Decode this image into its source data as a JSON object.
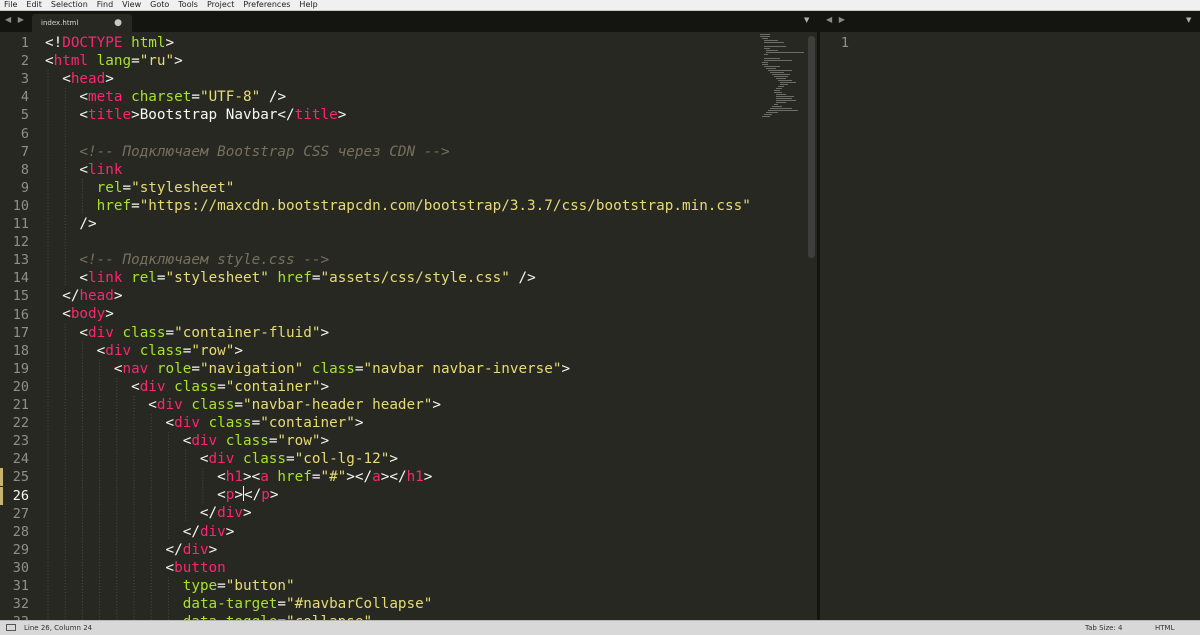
{
  "menu": [
    "File",
    "Edit",
    "Selection",
    "Find",
    "View",
    "Goto",
    "Tools",
    "Project",
    "Preferences",
    "Help"
  ],
  "tabs": {
    "left_arrows": "◀ ▶",
    "right_arrows": "◀ ▶",
    "active_file": "index.html",
    "dirty_marker": "●",
    "dropdown": "▼"
  },
  "editor_left": {
    "current_line": 26,
    "bookmarked_lines": [
      25,
      26
    ],
    "lines": [
      [
        [
          "p",
          "<!"
        ],
        [
          "t",
          "DOCTYPE"
        ],
        [
          "p",
          " "
        ],
        [
          "a",
          "html"
        ],
        [
          "p",
          ">"
        ]
      ],
      [
        [
          "p",
          "<"
        ],
        [
          "t",
          "html"
        ],
        [
          "p",
          " "
        ],
        [
          "a",
          "lang"
        ],
        [
          "p",
          "="
        ],
        [
          "s",
          "\"ru\""
        ],
        [
          "p",
          ">"
        ]
      ],
      [
        [
          "p",
          "  <"
        ],
        [
          "t",
          "head"
        ],
        [
          "p",
          ">"
        ]
      ],
      [
        [
          "p",
          "    <"
        ],
        [
          "t",
          "meta"
        ],
        [
          "p",
          " "
        ],
        [
          "a",
          "charset"
        ],
        [
          "p",
          "="
        ],
        [
          "s",
          "\"UTF-8\""
        ],
        [
          "p",
          " />"
        ]
      ],
      [
        [
          "p",
          "    <"
        ],
        [
          "t",
          "title"
        ],
        [
          "p",
          ">Bootstrap Navbar</"
        ],
        [
          "t",
          "title"
        ],
        [
          "p",
          ">"
        ]
      ],
      [],
      [
        [
          "c",
          "    <!-- Подключаем Bootstrap CSS через CDN -->"
        ]
      ],
      [
        [
          "p",
          "    <"
        ],
        [
          "t",
          "link"
        ]
      ],
      [
        [
          "p",
          "      "
        ],
        [
          "a",
          "rel"
        ],
        [
          "p",
          "="
        ],
        [
          "s",
          "\"stylesheet\""
        ]
      ],
      [
        [
          "p",
          "      "
        ],
        [
          "a",
          "href"
        ],
        [
          "p",
          "="
        ],
        [
          "s",
          "\"https://maxcdn.bootstrapcdn.com/bootstrap/3.3.7/css/bootstrap.min.css\""
        ]
      ],
      [
        [
          "p",
          "    />"
        ]
      ],
      [],
      [
        [
          "c",
          "    <!-- Подключаем style.css -->"
        ]
      ],
      [
        [
          "p",
          "    <"
        ],
        [
          "t",
          "link"
        ],
        [
          "p",
          " "
        ],
        [
          "a",
          "rel"
        ],
        [
          "p",
          "="
        ],
        [
          "s",
          "\"stylesheet\""
        ],
        [
          "p",
          " "
        ],
        [
          "a",
          "href"
        ],
        [
          "p",
          "="
        ],
        [
          "s",
          "\"assets/css/style.css\""
        ],
        [
          "p",
          " />"
        ]
      ],
      [
        [
          "p",
          "  </"
        ],
        [
          "t",
          "head"
        ],
        [
          "p",
          ">"
        ]
      ],
      [
        [
          "p",
          "  <"
        ],
        [
          "t",
          "body"
        ],
        [
          "p",
          ">"
        ]
      ],
      [
        [
          "p",
          "    <"
        ],
        [
          "t",
          "div"
        ],
        [
          "p",
          " "
        ],
        [
          "a",
          "class"
        ],
        [
          "p",
          "="
        ],
        [
          "s",
          "\"container-fluid\""
        ],
        [
          "p",
          ">"
        ]
      ],
      [
        [
          "p",
          "      <"
        ],
        [
          "t",
          "div"
        ],
        [
          "p",
          " "
        ],
        [
          "a",
          "class"
        ],
        [
          "p",
          "="
        ],
        [
          "s",
          "\"row\""
        ],
        [
          "p",
          ">"
        ]
      ],
      [
        [
          "p",
          "        <"
        ],
        [
          "t",
          "nav"
        ],
        [
          "p",
          " "
        ],
        [
          "a",
          "role"
        ],
        [
          "p",
          "="
        ],
        [
          "s",
          "\"navigation\""
        ],
        [
          "p",
          " "
        ],
        [
          "a",
          "class"
        ],
        [
          "p",
          "="
        ],
        [
          "s",
          "\"navbar navbar-inverse\""
        ],
        [
          "p",
          ">"
        ]
      ],
      [
        [
          "p",
          "          <"
        ],
        [
          "t",
          "div"
        ],
        [
          "p",
          " "
        ],
        [
          "a",
          "class"
        ],
        [
          "p",
          "="
        ],
        [
          "s",
          "\"container\""
        ],
        [
          "p",
          ">"
        ]
      ],
      [
        [
          "p",
          "            <"
        ],
        [
          "t",
          "div"
        ],
        [
          "p",
          " "
        ],
        [
          "a",
          "class"
        ],
        [
          "p",
          "="
        ],
        [
          "s",
          "\"navbar-header header\""
        ],
        [
          "p",
          ">"
        ]
      ],
      [
        [
          "p",
          "              <"
        ],
        [
          "t",
          "div"
        ],
        [
          "p",
          " "
        ],
        [
          "a",
          "class"
        ],
        [
          "p",
          "="
        ],
        [
          "s",
          "\"container\""
        ],
        [
          "p",
          ">"
        ]
      ],
      [
        [
          "p",
          "                <"
        ],
        [
          "t",
          "div"
        ],
        [
          "p",
          " "
        ],
        [
          "a",
          "class"
        ],
        [
          "p",
          "="
        ],
        [
          "s",
          "\"row\""
        ],
        [
          "p",
          ">"
        ]
      ],
      [
        [
          "p",
          "                  <"
        ],
        [
          "t",
          "div"
        ],
        [
          "p",
          " "
        ],
        [
          "a",
          "class"
        ],
        [
          "p",
          "="
        ],
        [
          "s",
          "\"col-lg-12\""
        ],
        [
          "p",
          ">"
        ]
      ],
      [
        [
          "p",
          "                    <"
        ],
        [
          "t",
          "h1"
        ],
        [
          "p",
          "><"
        ],
        [
          "t",
          "a"
        ],
        [
          "p",
          " "
        ],
        [
          "a",
          "href"
        ],
        [
          "p",
          "="
        ],
        [
          "s",
          "\"#\""
        ],
        [
          "p",
          "></"
        ],
        [
          "t",
          "a"
        ],
        [
          "p",
          "></"
        ],
        [
          "t",
          "h1"
        ],
        [
          "p",
          ">"
        ]
      ],
      [
        [
          "p",
          "                    <"
        ],
        [
          "t",
          "p"
        ],
        [
          "p",
          ">"
        ],
        [
          "cursor",
          ""
        ],
        [
          "p",
          "</"
        ],
        [
          "t",
          "p"
        ],
        [
          "p",
          ">"
        ]
      ],
      [
        [
          "p",
          "                  </"
        ],
        [
          "t",
          "div"
        ],
        [
          "p",
          ">"
        ]
      ],
      [
        [
          "p",
          "                </"
        ],
        [
          "t",
          "div"
        ],
        [
          "p",
          ">"
        ]
      ],
      [
        [
          "p",
          "              </"
        ],
        [
          "t",
          "div"
        ],
        [
          "p",
          ">"
        ]
      ],
      [
        [
          "p",
          "              <"
        ],
        [
          "t",
          "button"
        ]
      ],
      [
        [
          "p",
          "                "
        ],
        [
          "a",
          "type"
        ],
        [
          "p",
          "="
        ],
        [
          "s",
          "\"button\""
        ]
      ],
      [
        [
          "p",
          "                "
        ],
        [
          "a",
          "data-target"
        ],
        [
          "p",
          "="
        ],
        [
          "s",
          "\"#navbarCollapse\""
        ]
      ],
      [
        [
          "p",
          "                "
        ],
        [
          "a",
          "data-toggle"
        ],
        [
          "p",
          "="
        ],
        [
          "s",
          "\"collapse\""
        ]
      ]
    ]
  },
  "editor_right": {
    "lines": [
      "1"
    ]
  },
  "status": {
    "position": "Line 26, Column 24",
    "tab_size": "Tab Size: 4",
    "syntax": "HTML"
  }
}
